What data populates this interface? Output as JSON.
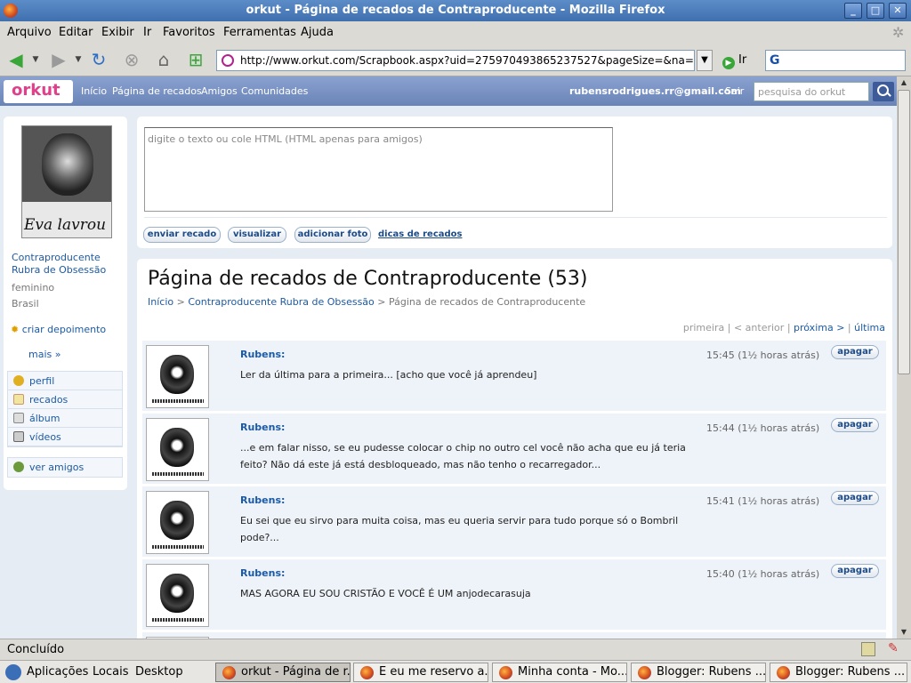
{
  "window": {
    "title": "orkut - Página de recados de Contraproducente - Mozilla Firefox"
  },
  "menu": [
    "Arquivo",
    "Editar",
    "Exibir",
    "Ir",
    "Favoritos",
    "Ferramentas",
    "Ajuda"
  ],
  "address": {
    "url": "http://www.orkut.com/Scrapbook.aspx?uid=275970493865237527&pageSize=&na=4&r",
    "go_label": "Ir"
  },
  "orkut_nav": {
    "logo": "orkut",
    "links": [
      "Início",
      "Página de recados",
      "Amigos",
      "Comunidades"
    ],
    "email": "rubensrodrigues.rr@gmail.com",
    "logout": "Sair",
    "search_placeholder": "pesquisa do orkut"
  },
  "profile": {
    "avatar_caption": "Eva lavrou",
    "name": "Contraproducente Rubra de Obsessão",
    "gender": "feminino",
    "country": "Brasil",
    "create_testimonial": "criar depoimento",
    "more": "mais »",
    "menu": [
      "perfil",
      "recados",
      "álbum",
      "vídeos"
    ],
    "see_friends": "ver amigos"
  },
  "composer": {
    "placeholder": "digite o texto ou cole HTML (HTML apenas para amigos)",
    "send": "enviar recado",
    "preview": "visualizar",
    "add_photo": "adicionar foto",
    "tips": "dicas de recados"
  },
  "scrapbook": {
    "title": "Página de recados de Contraproducente (53)",
    "breadcrumb": {
      "home": "Início",
      "sep1": ">",
      "profile": "Contraproducente Rubra de Obsessão",
      "sep2": ">",
      "current": "Página de recados de Contraproducente"
    },
    "pager": {
      "first": "primeira",
      "sep1": "|",
      "prev": "< anterior",
      "sep2": "|",
      "next": "próxima >",
      "sep3": "|",
      "last": "última"
    },
    "delete_label": "apagar",
    "scraps": [
      {
        "author": "Rubens:",
        "time": "15:45 (1½ horas atrás)",
        "message": "Ler da última para a primeira... [acho que você já aprendeu]"
      },
      {
        "author": "Rubens:",
        "time": "15:44 (1½ horas atrás)",
        "message": "...e em falar nisso, se eu pudesse colocar o chip no outro cel você não acha que eu já teria feito? Não dá este já está desbloqueado, mas não tenho o recarregador..."
      },
      {
        "author": "Rubens:",
        "time": "15:41 (1½ horas atrás)",
        "message": "Eu sei que eu sirvo para muita coisa, mas eu queria servir para tudo porque só o Bombril pode?..."
      },
      {
        "author": "Rubens:",
        "time": "15:40 (1½ horas atrás)",
        "message": "MAS AGORA EU SOU CRISTÃO E VOCÊ É UM anjodecarasuja"
      }
    ]
  },
  "status": {
    "text": "Concluído"
  },
  "taskbar": {
    "menus": [
      "Aplicações",
      "Locais",
      "Desktop"
    ],
    "tasks": [
      "orkut - Página de r...",
      "E eu me reservo a...",
      "Minha conta - Mo...",
      "Blogger: Rubens ...",
      "Blogger: Rubens ..."
    ]
  }
}
